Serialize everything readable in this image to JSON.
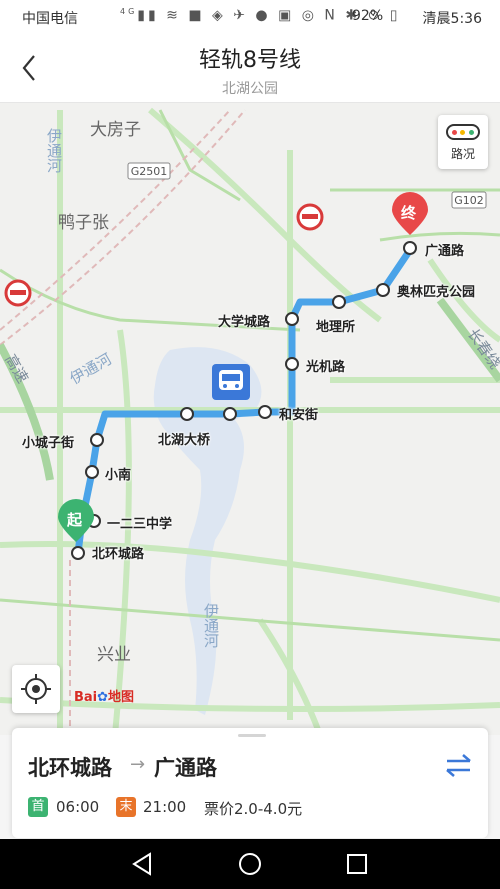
{
  "status_bar": {
    "carrier": "中国电信",
    "network": "4G",
    "battery": "92%",
    "status_text": "清晨",
    "time": "5:36"
  },
  "header": {
    "title": "轻轨8号线",
    "subtitle": "北湖公园"
  },
  "map": {
    "traffic_button_label": "路况",
    "line_color": "#4aa3e8",
    "places": [
      "大房子",
      "鸭子张",
      "兴业"
    ],
    "rivers": [
      "伊通河",
      "伊通河",
      "伊通河"
    ],
    "road_shields": [
      "G2501",
      "G102"
    ],
    "road_names": [
      "长春绕",
      "高速"
    ],
    "start_marker": "起",
    "end_marker": "终",
    "stations": [
      "北环城路",
      "一二三中学",
      "小南",
      "小城子街",
      "北湖大桥",
      "和安街",
      "光机路",
      "大学城路",
      "地理所",
      "奥林匹克公园",
      "广通路"
    ],
    "logo_text": "Bai",
    "logo_suffix": "地图"
  },
  "route_card": {
    "from": "北环城路",
    "to": "广通路",
    "arrow": "→",
    "first_badge": "首",
    "first_time": "06:00",
    "last_badge": "末",
    "last_time": "21:00",
    "fare": "票价2.0-4.0元"
  }
}
